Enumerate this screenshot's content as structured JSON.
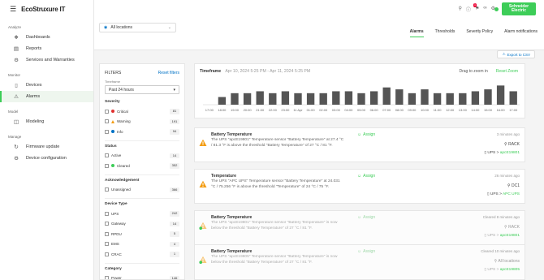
{
  "app": {
    "name": "EcoStruxure IT"
  },
  "sidebar": {
    "sections": [
      {
        "title": "Analyze",
        "items": [
          {
            "label": "Dashboards",
            "icon": "dashboard-icon",
            "glyph": "❖"
          },
          {
            "label": "Reports",
            "icon": "reports-icon",
            "glyph": "▤"
          },
          {
            "label": "Services and Warranties",
            "icon": "services-icon",
            "glyph": "⚙"
          }
        ]
      },
      {
        "title": "Monitor",
        "items": [
          {
            "label": "Devices",
            "icon": "devices-icon",
            "glyph": "▯"
          },
          {
            "label": "Alarms",
            "icon": "alarm-icon",
            "glyph": "⚠",
            "active": true
          }
        ]
      },
      {
        "title": "Model",
        "items": [
          {
            "label": "Modeling",
            "icon": "modeling-icon",
            "glyph": "◫"
          }
        ]
      },
      {
        "title": "Manage",
        "items": [
          {
            "label": "Firmware update",
            "icon": "firmware-icon",
            "glyph": "↻"
          },
          {
            "label": "Device configuration",
            "icon": "configuration-icon",
            "glyph": "⚙"
          }
        ]
      }
    ]
  },
  "topbar": {
    "notification_count": "1",
    "brand_logo": "Schneider Electric"
  },
  "location": {
    "label": "All locations"
  },
  "tabs": [
    {
      "label": "Alarms",
      "active": true
    },
    {
      "label": "Thresholds"
    },
    {
      "label": "Severity Policy"
    },
    {
      "label": "Alarm notifications"
    }
  ],
  "export": {
    "label": "Export to CSV"
  },
  "filters": {
    "title": "FILTERS",
    "reset": "Reset filters",
    "timeframe_label": "Timeframe",
    "timeframe_value": "Past 24 hours",
    "groups": [
      {
        "title": "Severity",
        "items": [
          {
            "label": "Critical",
            "count": "81",
            "marker": "critical"
          },
          {
            "label": "Warning",
            "count": "191",
            "marker": "warning"
          },
          {
            "label": "Info",
            "count": "94",
            "marker": "info"
          }
        ]
      },
      {
        "title": "Status",
        "items": [
          {
            "label": "Active",
            "count": "14"
          },
          {
            "label": "Cleared",
            "count": "352",
            "marker": "cleared"
          }
        ]
      },
      {
        "title": "Acknowledgement",
        "items": [
          {
            "label": "Unassigned",
            "count": "366"
          }
        ]
      },
      {
        "title": "Device Type",
        "items": [
          {
            "label": "UPS",
            "count": "242"
          },
          {
            "label": "Gateway",
            "count": "14"
          },
          {
            "label": "RPDU",
            "count": "5"
          },
          {
            "label": "EMS",
            "count": "4"
          },
          {
            "label": "CRAC",
            "count": "1"
          }
        ]
      },
      {
        "title": "Category",
        "items": [
          {
            "label": "Power",
            "count": "146"
          }
        ]
      }
    ]
  },
  "timeframe": {
    "label": "Timeframe",
    "range": "Apr 10, 2024 5:25 PM  -  Apr 11, 2024 5:25 PM",
    "drag_hint": "Drag to zoom in",
    "reset_zoom": "Reset Zoom"
  },
  "chart_data": {
    "type": "bar",
    "categories": [
      "17:00",
      "18:00",
      "19:00",
      "20:00",
      "21:00",
      "22:00",
      "23:00",
      "11 Apr",
      "01:00",
      "02:00",
      "03:00",
      "04:00",
      "05:00",
      "06:00",
      "07:00",
      "08:00",
      "09:00",
      "10:00",
      "11:00",
      "12:00",
      "13:00",
      "14:00",
      "15:00",
      "16:00",
      "17:00"
    ],
    "values": [
      0,
      8,
      12,
      12,
      14,
      12,
      14,
      12,
      12,
      12,
      14,
      14,
      12,
      14,
      18,
      16,
      12,
      16,
      12,
      12,
      12,
      14,
      16,
      20,
      14
    ],
    "ylim": [
      0,
      22
    ],
    "color": "#555555"
  },
  "alarms": [
    {
      "title": "Battery Temperature",
      "text": "The UPS \"apcE19801\" Temperature sensor \"Battery Temperature\" at 27.4 °C / 81.3 °F is above the threshold \"Battery Temperature\" of 27 °C / 81 °F.",
      "assign": "Assign",
      "time": "3 minutes ago",
      "location": "RACK",
      "device_type": "UPS",
      "device": "apcE19801",
      "severity": "warning",
      "cleared": false
    },
    {
      "title": "Temperature",
      "text": "The UPS \"APC UPS\" Temperature sensor \"Battery Temperature\" at 24.031 °C / 75.256 °F is above the threshold \"Temperature\" of 24 °C / 75 °F.",
      "assign": "Assign",
      "time": "26 minutes ago",
      "location": "DC1",
      "device_type": "UPS",
      "device": "APC UPS",
      "severity": "warning",
      "cleared": false
    },
    {
      "title": "Battery Temperature",
      "text": "The UPS \"apcE19801\" Temperature sensor \"Battery Temperature\" is now below the threshold \"Battery Temperature\" of 27 °C / 81 °F.",
      "assign": "Assign",
      "time": "Cleared 8 minutes ago",
      "location": "RACK",
      "device_type": "UPS",
      "device": "apcE19801",
      "severity": "warning",
      "cleared": true
    },
    {
      "title": "Battery Temperature",
      "text": "The UPS \"apcE19805\" Temperature sensor \"Battery Temperature\" is now below the threshold \"Battery Temperature\" of 27 °C / 81 °F.",
      "assign": "Assign",
      "time": "Cleared 10 minutes ago",
      "location": "All locations",
      "device_type": "UPS",
      "device": "apcE19805",
      "severity": "warning",
      "cleared": true
    }
  ]
}
